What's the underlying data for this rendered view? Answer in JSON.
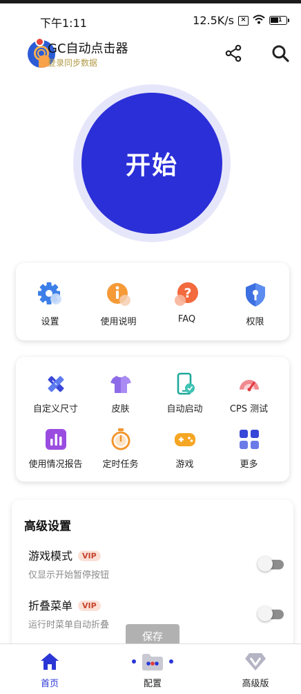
{
  "status_bar": {
    "time": "下午1:11",
    "network_speed": "12.5K/s",
    "battery_level": "51"
  },
  "header": {
    "app_name": "GC自动点击器",
    "subtitle": "登录同步数据"
  },
  "start_button": {
    "label": "开始",
    "color": "#2b2fd8"
  },
  "quick_menu": [
    {
      "label": "设置",
      "icon": "gear-icon"
    },
    {
      "label": "使用说明",
      "icon": "info-icon"
    },
    {
      "label": "FAQ",
      "icon": "question-icon"
    },
    {
      "label": "权限",
      "icon": "shield-key-icon"
    }
  ],
  "tools_menu": [
    {
      "label": "自定义尺寸",
      "icon": "ruler-pencil-icon"
    },
    {
      "label": "皮肤",
      "icon": "tshirt-icon"
    },
    {
      "label": "自动启动",
      "icon": "phone-auto-icon"
    },
    {
      "label": "CPS 测试",
      "icon": "speedometer-icon"
    },
    {
      "label": "使用情况报告",
      "icon": "bar-chart-icon"
    },
    {
      "label": "定时任务",
      "icon": "stopwatch-icon"
    },
    {
      "label": "游戏",
      "icon": "gamepad-icon"
    },
    {
      "label": "更多",
      "icon": "grid-icon"
    }
  ],
  "advanced": {
    "title": "高级设置",
    "vip_badge": "VIP",
    "options": [
      {
        "name": "游戏模式",
        "description": "仅显示开始暂停按钮",
        "enabled": false
      },
      {
        "name": "折叠菜单",
        "description": "运行时菜单自动折叠",
        "enabled": false
      }
    ]
  },
  "save_toast": "保存",
  "bottom_nav": [
    {
      "label": "首页",
      "icon": "home-icon",
      "active": true
    },
    {
      "label": "配置",
      "icon": "folder-icon",
      "active": false
    },
    {
      "label": "高级版",
      "icon": "vip-diamond-icon",
      "active": false
    }
  ],
  "colors": {
    "accent": "#2b2fd8",
    "vip_text": "#c7462f",
    "vip_bg": "#fbe0d6"
  }
}
